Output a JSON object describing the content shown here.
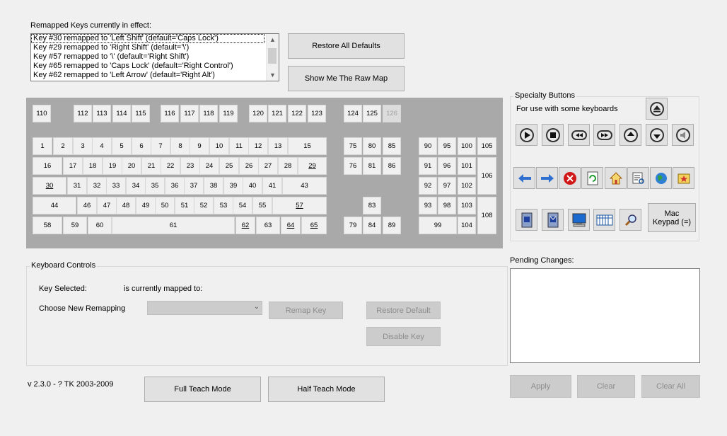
{
  "remapped": {
    "heading": "Remapped Keys currently in effect:",
    "items": [
      "Key #30 remapped to 'Left Shift' (default='Caps Lock')",
      "Key #29 remapped to 'Right Shift' (default='\\')",
      "Key #57 remapped to '\\' (default='Right Shift')",
      "Key #65 remapped to 'Caps Lock' (default='Right Control')",
      "Key #62 remapped to 'Left Arrow' (default='Right Alt')"
    ]
  },
  "buttons": {
    "restore_all": "Restore All Defaults",
    "raw_map": "Show Me The Raw Map",
    "remap_key": "Remap Key",
    "restore_default": "Restore Default",
    "disable_key": "Disable Key",
    "full_teach": "Full Teach Mode",
    "half_teach": "Half Teach Mode",
    "apply": "Apply",
    "clear": "Clear",
    "clear_all": "Clear All",
    "mac_keypad": "Mac Keypad (=)"
  },
  "specialty": {
    "title": "Specialty Buttons",
    "subtitle": "For use with some keyboards",
    "icons": [
      "eject-icon",
      "play-icon",
      "stop-icon",
      "rewind-icon",
      "fast-forward-icon",
      "volume-up-icon",
      "volume-down-icon",
      "mute-icon",
      "back-arrow-icon",
      "forward-arrow-icon",
      "stop-web-icon",
      "refresh-icon",
      "home-icon",
      "search-doc-icon",
      "web-globe-icon",
      "favorites-icon",
      "my-computer-icon",
      "mail-icon",
      "computer-icon",
      "calculator-icon",
      "magnifier-icon"
    ]
  },
  "controls": {
    "title": "Keyboard Controls",
    "key_selected": "Key Selected:",
    "currently_mapped": "is currently mapped to:",
    "choose_new": "Choose New Remapping",
    "select_value": ""
  },
  "pending": {
    "label": "Pending Changes:",
    "value": ""
  },
  "version": "v 2.3.0 - ? TK 2003-2009",
  "keyboard": {
    "keys": [
      {
        "label": "110"
      },
      {
        "label": "112"
      },
      {
        "label": "113"
      },
      {
        "label": "114"
      },
      {
        "label": "115"
      },
      {
        "label": "116"
      },
      {
        "label": "117"
      },
      {
        "label": "118"
      },
      {
        "label": "119"
      },
      {
        "label": "120"
      },
      {
        "label": "121"
      },
      {
        "label": "122"
      },
      {
        "label": "123"
      },
      {
        "label": "124"
      },
      {
        "label": "125"
      },
      {
        "label": "126",
        "dim": true
      },
      {
        "label": "1"
      },
      {
        "label": "2"
      },
      {
        "label": "3"
      },
      {
        "label": "4"
      },
      {
        "label": "5"
      },
      {
        "label": "6"
      },
      {
        "label": "7"
      },
      {
        "label": "8"
      },
      {
        "label": "9"
      },
      {
        "label": "10"
      },
      {
        "label": "11"
      },
      {
        "label": "12"
      },
      {
        "label": "13"
      },
      {
        "label": "15"
      },
      {
        "label": "16"
      },
      {
        "label": "17"
      },
      {
        "label": "18"
      },
      {
        "label": "19"
      },
      {
        "label": "20"
      },
      {
        "label": "21"
      },
      {
        "label": "22"
      },
      {
        "label": "23"
      },
      {
        "label": "24"
      },
      {
        "label": "25"
      },
      {
        "label": "26"
      },
      {
        "label": "27"
      },
      {
        "label": "28"
      },
      {
        "label": "29",
        "ul": true
      },
      {
        "label": "30",
        "ul": true
      },
      {
        "label": "31"
      },
      {
        "label": "32"
      },
      {
        "label": "33"
      },
      {
        "label": "34"
      },
      {
        "label": "35"
      },
      {
        "label": "36"
      },
      {
        "label": "37"
      },
      {
        "label": "38"
      },
      {
        "label": "39"
      },
      {
        "label": "40"
      },
      {
        "label": "41"
      },
      {
        "label": "43"
      },
      {
        "label": "44"
      },
      {
        "label": "46"
      },
      {
        "label": "47"
      },
      {
        "label": "48"
      },
      {
        "label": "49"
      },
      {
        "label": "50"
      },
      {
        "label": "51"
      },
      {
        "label": "52"
      },
      {
        "label": "53"
      },
      {
        "label": "54"
      },
      {
        "label": "55"
      },
      {
        "label": "57",
        "ul": true
      },
      {
        "label": "58"
      },
      {
        "label": "59"
      },
      {
        "label": "60"
      },
      {
        "label": "61"
      },
      {
        "label": "62",
        "ul": true
      },
      {
        "label": "63"
      },
      {
        "label": "64",
        "ul": true
      },
      {
        "label": "65",
        "ul": true
      },
      {
        "label": "75"
      },
      {
        "label": "80"
      },
      {
        "label": "85"
      },
      {
        "label": "76"
      },
      {
        "label": "81"
      },
      {
        "label": "86"
      },
      {
        "label": "83"
      },
      {
        "label": "79"
      },
      {
        "label": "84"
      },
      {
        "label": "89"
      },
      {
        "label": "90"
      },
      {
        "label": "95"
      },
      {
        "label": "100"
      },
      {
        "label": "105"
      },
      {
        "label": "91"
      },
      {
        "label": "96"
      },
      {
        "label": "101"
      },
      {
        "label": "106"
      },
      {
        "label": "92"
      },
      {
        "label": "97"
      },
      {
        "label": "102"
      },
      {
        "label": "93"
      },
      {
        "label": "98"
      },
      {
        "label": "103"
      },
      {
        "label": "108"
      },
      {
        "label": "99"
      },
      {
        "label": "104"
      }
    ]
  }
}
